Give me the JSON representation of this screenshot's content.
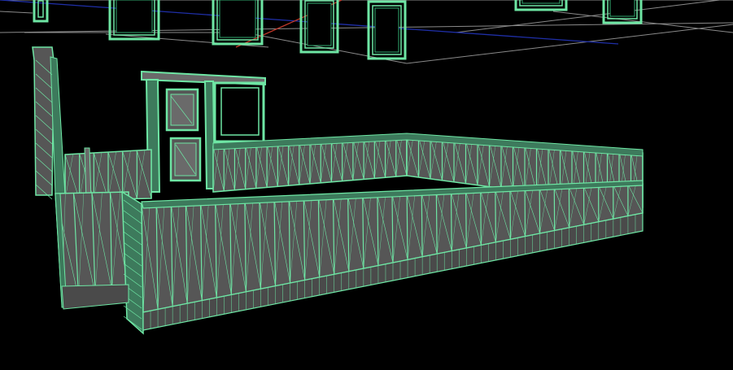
{
  "app": {
    "view": "3d-wireframe-viewport",
    "render_mode": "shaded-wireframe"
  },
  "scene": {
    "objects": [
      "upper-storey-windows",
      "grid-plane",
      "x-axis-line",
      "z-axis-line",
      "door-frame",
      "left-post",
      "back-fence",
      "front-fence"
    ]
  },
  "colors": {
    "background": "#000000",
    "wire": "#6ee6a4",
    "wire_dark": "#2fa86e",
    "face": "#565656",
    "face_light": "#6a6a6a",
    "grid": "#9a9a9a",
    "axis_x": "#c0392b",
    "axis_z": "#1f2fa8"
  }
}
